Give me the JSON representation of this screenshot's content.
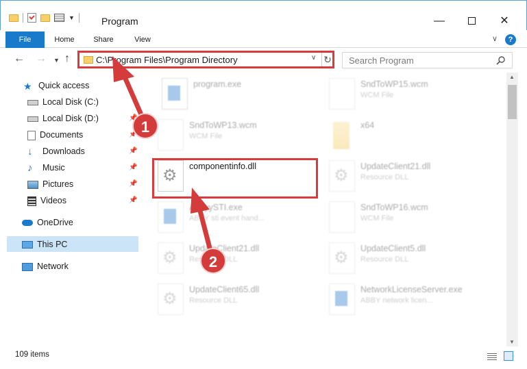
{
  "window": {
    "title": "Program",
    "minimize_glyph": "—",
    "close_glyph": "✕"
  },
  "ribbon": {
    "tabs": [
      "File",
      "Home",
      "Share",
      "View"
    ],
    "help_glyph": "?"
  },
  "navigation": {
    "address": "C:\\Program Files\\Program Directory",
    "search_placeholder": "Search Program"
  },
  "sidebar": {
    "items": [
      {
        "label": "Quick access",
        "icon": "star-icon"
      },
      {
        "label": "Local Disk (C:)",
        "icon": "drive-icon"
      },
      {
        "label": "Local Disk (D:)",
        "icon": "drive-icon"
      },
      {
        "label": "Documents",
        "icon": "documents-icon",
        "pinned": true
      },
      {
        "label": "Downloads",
        "icon": "download-icon",
        "pinned": true
      },
      {
        "label": "Music",
        "icon": "music-icon",
        "pinned": true
      },
      {
        "label": "Pictures",
        "icon": "pictures-icon",
        "pinned": true
      },
      {
        "label": "Videos",
        "icon": "videos-icon",
        "pinned": true
      },
      {
        "label": "OneDrive",
        "icon": "onedrive-icon"
      },
      {
        "label": "This PC",
        "icon": "computer-icon",
        "selected": true
      },
      {
        "label": "Network",
        "icon": "network-icon"
      }
    ]
  },
  "files": [
    {
      "name": "program.exe",
      "type": "",
      "icon": "exe-icon"
    },
    {
      "name": "SndToWP15.wcm",
      "type": "WCM File",
      "icon": "file-icon"
    },
    {
      "name": "SndToWP13.wcm",
      "type": "WCM File",
      "icon": "file-icon"
    },
    {
      "name": "x64",
      "type": "",
      "icon": "folder-icon"
    },
    {
      "name": "componentinfo.dll",
      "type": "",
      "icon": "dll-gear-icon"
    },
    {
      "name": "UpdateClient21.dll",
      "type": "Resource DLL",
      "icon": "dll-gear-icon"
    },
    {
      "name": "AbbyySTI.exe",
      "type": "ABBY sti event hand...",
      "icon": "exe-icon"
    },
    {
      "name": "SndToWP16.wcm",
      "type": "WCM File",
      "icon": "file-icon"
    },
    {
      "name": "UpdateClient21.dll",
      "type": "Resource DLL",
      "icon": "dll-gear-icon"
    },
    {
      "name": "UpdateClient5.dll",
      "type": "Resource DLL",
      "icon": "dll-gear-icon"
    },
    {
      "name": "UpdateClient65.dll",
      "type": "Resource DLL",
      "icon": "dll-gear-icon"
    },
    {
      "name": "NetworkLicenseServer.exe",
      "type": "ABBY network licen...",
      "icon": "exe-icon"
    }
  ],
  "status": {
    "item_count": "109 items"
  },
  "annotations": {
    "step1": "1",
    "step2": "2",
    "color": "#d43b3b"
  }
}
